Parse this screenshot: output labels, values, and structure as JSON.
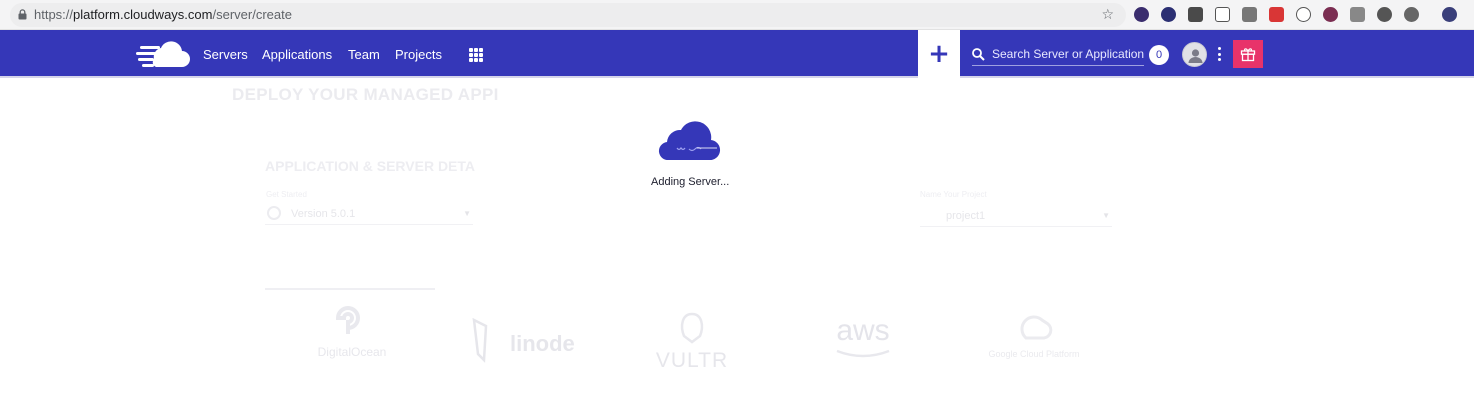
{
  "browser": {
    "url_scheme": "https://",
    "url_host": "platform.cloudways.com",
    "url_path": "/server/create"
  },
  "topbar": {
    "background": "#3537b8",
    "nav": [
      "Servers",
      "Applications",
      "Team",
      "Projects"
    ],
    "add_label": "+",
    "search_placeholder": "Search Server or Application",
    "notification_count": "0",
    "gift_color": "#e8336a"
  },
  "background_page": {
    "deploy_title": "DEPLOY YOUR MANAGED APPI",
    "section_title": "APPLICATION & SERVER DETA",
    "left_field_label": "Get Started",
    "left_field_value": "Version 5.0.1",
    "right_field_label": "Name Your Project",
    "right_field_value": "project1",
    "providers": [
      "DigitalOcean",
      "linode",
      "VULTR",
      "aws",
      "Google Cloud Platform"
    ]
  },
  "loader": {
    "text": "Adding Server...",
    "cloud_color": "#3537b8"
  }
}
